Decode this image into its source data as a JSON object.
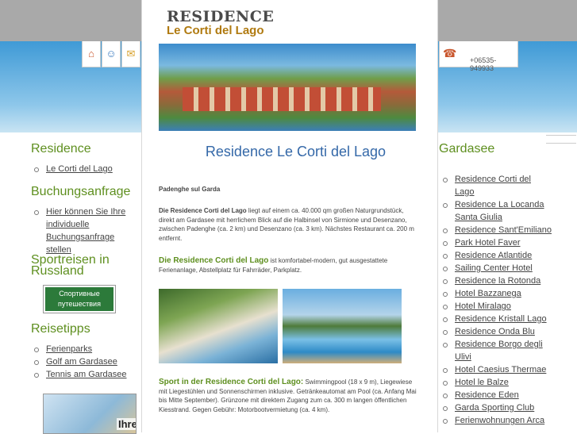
{
  "header": {
    "logo_line1": "RESIDENCE",
    "logo_line2": "Le Corti del Lago",
    "phone": "+06535-949933",
    "icons": [
      "home-icon",
      "people-icon",
      "mail-icon",
      "phone-icon"
    ]
  },
  "left": {
    "sections": [
      {
        "title": "Residence",
        "items": [
          "Le Corti del Lago"
        ]
      },
      {
        "title": "Buchungsanfrage",
        "items": [
          "Hier können Sie Ihre individuelle Buchungsanfrage stellen"
        ]
      },
      {
        "title": "Sportreisen in Russland",
        "items": []
      },
      {
        "title": "Reisetipps",
        "items": [
          "Ferienparks",
          "Golf am Gardasee",
          "Tennis am Gardasee"
        ]
      }
    ],
    "ru_banner": {
      "line1": "Спортивные",
      "line2": "путешествия"
    },
    "map_label": "Ihre"
  },
  "main": {
    "title": "Residence Le Corti del Lago",
    "location": "Padenghe sul Garda",
    "p1_strong": "Die Residence Corti del Lago",
    "p1_text": " liegt auf einem ca. 40.000 qm großen Naturgrundstück, direkt am Gardasee mit herrlichem Blick auf die Halbinsel von Sirmione und Desenzano, zwischen Padenghe (ca. 2 km) und Desenzano (ca. 3 km). Nächstes Restaurant ca. 200 m entfernt.",
    "p2_strong": "Die Residence Corti del Lago",
    "p2_text": " ist komfortabel-modern, gut ausgestattete Ferienanlage, Abstellplatz für Fahrräder, Parkplatz.",
    "p3_strong": "Sport in der Residence Corti del Lago:",
    "p3_text": " Swimmingpool (18 x 9 m), Liegewiese mit Liegestühlen und Sonnenschirmen inklusive. Getränkeautomat am Pool (ca. Anfang Mai bis Mitte September). Grünzone mit direktem Zugang zum ca. 300 m langen öffentlichen Kiesstrand. Gegen Gebühr: Motorbootvermietung (ca. 4 km)."
  },
  "right": {
    "title": "Gardasee",
    "items": [
      "Residence Corti del Lago",
      "Residence La Locanda Santa Giulia",
      "Residence Sant'Emiliano",
      "Park Hotel Faver",
      "Residence Atlantide",
      "Sailing Center Hotel",
      "Residence la Rotonda",
      "Hotel Bazzanega",
      "Hotel Miralago",
      "Residence Kristall Lago",
      "Residence Onda Blu",
      "Residence Borgo degli Ulivi",
      "Hotel Caesius Thermae",
      "Hotel le Balze",
      "Residence Eden",
      "Garda Sporting Club",
      "Ferienwohnungen Arca"
    ]
  }
}
